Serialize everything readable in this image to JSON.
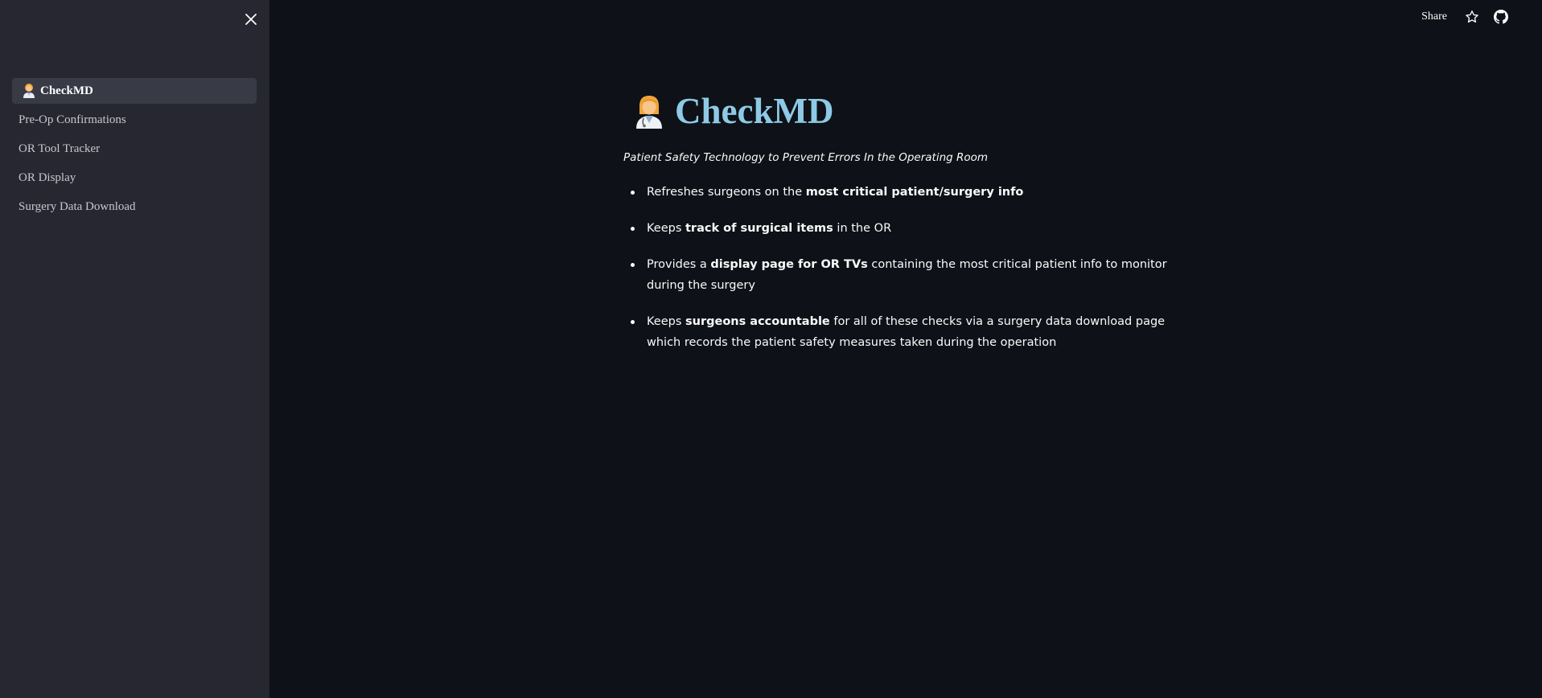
{
  "sidebar": {
    "close_icon": "close-icon",
    "items": [
      {
        "label": "CheckMD",
        "emoji": "doctor-emoji-icon",
        "active": true
      },
      {
        "label": "Pre-Op Confirmations"
      },
      {
        "label": "OR Tool Tracker"
      },
      {
        "label": "OR Display"
      },
      {
        "label": "Surgery Data Download"
      }
    ]
  },
  "header": {
    "share_label": "Share",
    "icons": [
      "star-icon",
      "github-icon"
    ]
  },
  "main": {
    "title": "CheckMD",
    "subtitle": "Patient Safety Technology to Prevent Errors In the Operating Room",
    "bullets": [
      {
        "pre": "Refreshes surgeons on the ",
        "bold": "most critical patient/surgery info",
        "post": ""
      },
      {
        "pre": "Keeps ",
        "bold": "track of surgical items",
        "post": " in the OR"
      },
      {
        "pre": "Provides a ",
        "bold": "display page for OR TVs",
        "post": " containing the most critical patient info to monitor during the surgery"
      },
      {
        "pre": "Keeps ",
        "bold": "surgeons accountable",
        "post": " for all of these checks via a surgery data download page which records the patient safety measures taken during the operation"
      }
    ]
  },
  "colors": {
    "background": "#0e1117",
    "sidebar": "#262730",
    "active_item": "#383a46",
    "title": "#8ecae6",
    "text": "#fafafa"
  }
}
